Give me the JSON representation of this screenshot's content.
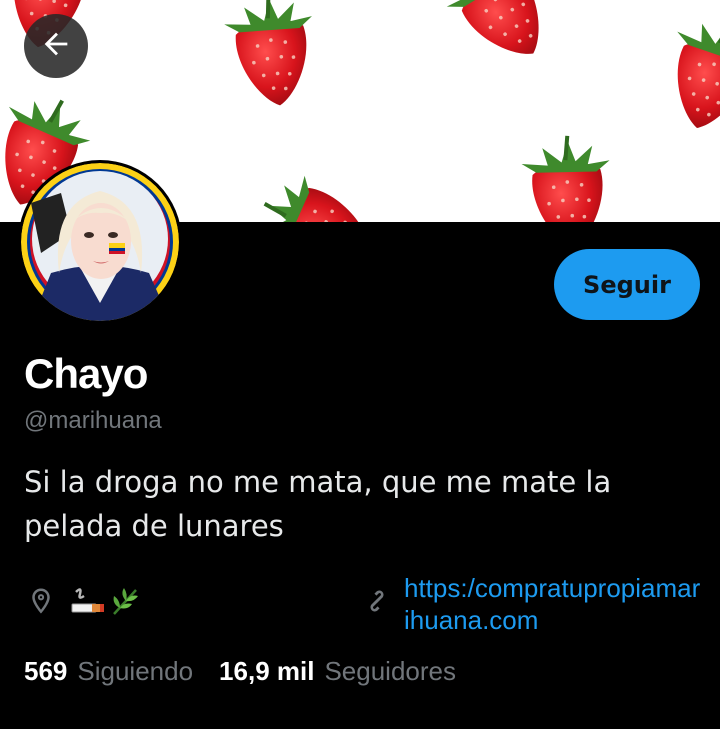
{
  "profile": {
    "name": "Chayo",
    "handle": "@marihuana",
    "bio": "Si la droga no me mata, que me mate la pelada de lunares",
    "link": "https:/compratupropiamarihuana.com",
    "location_emojis": [
      "cigarette",
      "herb"
    ]
  },
  "actions": {
    "follow_label": "Seguir"
  },
  "stats": {
    "following_count": "569",
    "following_label": "Siguiendo",
    "followers_count": "16,9 mil",
    "followers_label": "Seguidores"
  },
  "icons": {
    "back": "arrow-left-icon",
    "location": "location-pin-icon",
    "link": "link-icon"
  },
  "colors": {
    "accent": "#1d9bf0",
    "background": "#000000",
    "muted": "#71767b"
  }
}
